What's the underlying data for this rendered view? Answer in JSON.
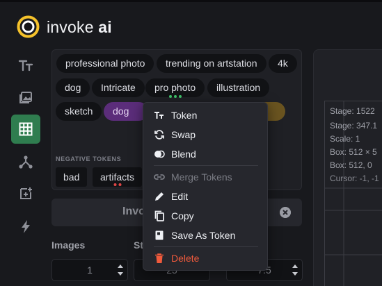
{
  "app": {
    "brand_prefix": "invoke",
    "brand_suffix": "ai"
  },
  "sidebar": {
    "items": [
      {
        "name": "text-to-image",
        "active": false
      },
      {
        "name": "image-to-image",
        "active": false
      },
      {
        "name": "unified-canvas",
        "active": true
      },
      {
        "name": "nodes",
        "active": false
      },
      {
        "name": "model-manager",
        "active": false
      },
      {
        "name": "queue",
        "active": false
      }
    ]
  },
  "prompt": {
    "tokens": [
      {
        "label": "professional photo",
        "style": "default"
      },
      {
        "label": "trending on artstation",
        "style": "default"
      },
      {
        "label": "4k",
        "style": "default"
      },
      {
        "label": "dog",
        "style": "default"
      },
      {
        "label": "Intricate",
        "style": "default"
      },
      {
        "label": "pro photo",
        "style": "default"
      },
      {
        "label": "illustration",
        "style": "default"
      },
      {
        "label": "sketch",
        "style": "default"
      },
      {
        "label": "dog",
        "style": "purple"
      },
      {
        "label": "re",
        "style": "gold"
      }
    ],
    "negative_label": "NEGATIVE TOKENS",
    "negative_tokens": [
      "bad",
      "artifacts"
    ]
  },
  "invoke": {
    "label": "Invo"
  },
  "params": {
    "images_label": "Images",
    "images_value": "1",
    "steps_label": "St",
    "steps_value": "25",
    "cfg_value": "7.5"
  },
  "canvas_info": {
    "stage_dims": "Stage: 1522",
    "stage_pos": "Stage: 347.1",
    "scale": "Scale: 1",
    "box_dims": "Box: 512 × 5",
    "box_pos": "Box: 512, 0",
    "cursor": "Cursor: -1, -1"
  },
  "context_menu": {
    "token": "Token",
    "swap": "Swap",
    "blend": "Blend",
    "merge_tokens": "Merge Tokens",
    "edit": "Edit",
    "copy": "Copy",
    "save_as_token": "Save As Token",
    "delete": "Delete"
  },
  "colors": {
    "accent_green": "#2f7d4f",
    "danger": "#f05a3c",
    "purple_chip": "#5b2d7a",
    "gold_chip": "#6a5420"
  }
}
